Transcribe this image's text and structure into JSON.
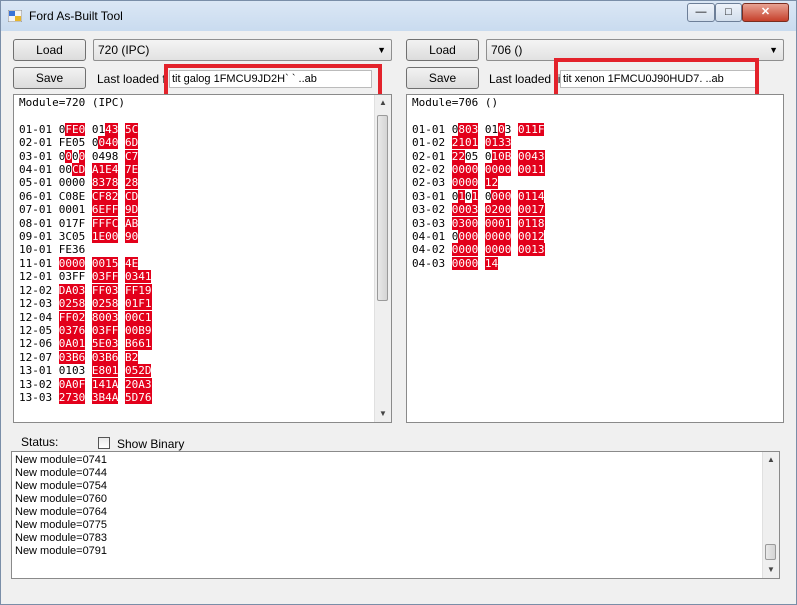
{
  "window": {
    "title": "Ford As-Built Tool",
    "min": "—",
    "max": "□",
    "close": "✕"
  },
  "left": {
    "load_label": "Load",
    "save_label": "Save",
    "module_select": "720 (IPC)",
    "last_loaded_label": "Last loaded file",
    "file_name": "tit galog 1FMCU9JD2H` ` ..ab",
    "header": "Module=720 (IPC)",
    "rows": [
      [
        {
          "t": "01-01 0"
        },
        {
          "t": "FE0",
          "r": 1
        },
        {
          "t": " 01"
        },
        {
          "t": "43",
          "r": 1
        },
        {
          "t": " "
        },
        {
          "t": "5C",
          "r": 1
        }
      ],
      [
        {
          "t": "02-01 FE05 0"
        },
        {
          "t": "040",
          "r": 1
        },
        {
          "t": " "
        },
        {
          "t": "6D",
          "r": 1
        }
      ],
      [
        {
          "t": "03-01 0"
        },
        {
          "t": "0",
          "r": 1
        },
        {
          "t": "0"
        },
        {
          "t": "0",
          "r": 1
        },
        {
          "t": " 0498 "
        },
        {
          "t": "C7",
          "r": 1
        }
      ],
      [
        {
          "t": "04-01 00"
        },
        {
          "t": "CD",
          "r": 1
        },
        {
          "t": " "
        },
        {
          "t": "A1E4",
          "r": 1
        },
        {
          "t": " "
        },
        {
          "t": "7E",
          "r": 1
        }
      ],
      [
        {
          "t": "05-01 0000 "
        },
        {
          "t": "8378",
          "r": 1
        },
        {
          "t": " "
        },
        {
          "t": "28",
          "r": 1
        }
      ],
      [
        {
          "t": "06-01 C08E "
        },
        {
          "t": "CF82",
          "r": 1
        },
        {
          "t": " "
        },
        {
          "t": "CD",
          "r": 1
        }
      ],
      [
        {
          "t": "07-01 0001 "
        },
        {
          "t": "6EFF",
          "r": 1
        },
        {
          "t": " "
        },
        {
          "t": "9D",
          "r": 1
        }
      ],
      [
        {
          "t": "08-01 017F "
        },
        {
          "t": "FFFC",
          "r": 1
        },
        {
          "t": " "
        },
        {
          "t": "AB",
          "r": 1
        }
      ],
      [
        {
          "t": "09-01 3C05 "
        },
        {
          "t": "1E00",
          "r": 1
        },
        {
          "t": " "
        },
        {
          "t": "90",
          "r": 1
        }
      ],
      [
        {
          "t": "10-01 FE36"
        }
      ],
      [
        {
          "t": "11-01 "
        },
        {
          "t": "0000",
          "r": 1
        },
        {
          "t": " "
        },
        {
          "t": "0015",
          "r": 1
        },
        {
          "t": " "
        },
        {
          "t": "4E",
          "r": 1
        }
      ],
      [
        {
          "t": "12-01 03FF "
        },
        {
          "t": "03FF",
          "r": 1
        },
        {
          "t": " "
        },
        {
          "t": "0341",
          "r": 1
        }
      ],
      [
        {
          "t": "12-02 "
        },
        {
          "t": "DA03",
          "r": 1
        },
        {
          "t": " "
        },
        {
          "t": "FF03",
          "r": 1
        },
        {
          "t": " "
        },
        {
          "t": "FF19",
          "r": 1
        }
      ],
      [
        {
          "t": "12-03 "
        },
        {
          "t": "0258",
          "r": 1
        },
        {
          "t": " "
        },
        {
          "t": "0258",
          "r": 1
        },
        {
          "t": " "
        },
        {
          "t": "01F1",
          "r": 1
        }
      ],
      [
        {
          "t": "12-04 "
        },
        {
          "t": "FF02",
          "r": 1
        },
        {
          "t": " "
        },
        {
          "t": "8003",
          "r": 1
        },
        {
          "t": " "
        },
        {
          "t": "00C1",
          "r": 1
        }
      ],
      [
        {
          "t": "12-05 "
        },
        {
          "t": "0376",
          "r": 1
        },
        {
          "t": " "
        },
        {
          "t": "03FF",
          "r": 1
        },
        {
          "t": " "
        },
        {
          "t": "00B9",
          "r": 1
        }
      ],
      [
        {
          "t": "12-06 "
        },
        {
          "t": "0A01",
          "r": 1
        },
        {
          "t": " "
        },
        {
          "t": "5E03",
          "r": 1
        },
        {
          "t": " "
        },
        {
          "t": "B661",
          "r": 1
        }
      ],
      [
        {
          "t": "12-07 "
        },
        {
          "t": "03B6",
          "r": 1
        },
        {
          "t": " "
        },
        {
          "t": "03B6",
          "r": 1
        },
        {
          "t": " "
        },
        {
          "t": "B2",
          "r": 1
        }
      ],
      [
        {
          "t": "13-01 0103 "
        },
        {
          "t": "E801",
          "r": 1
        },
        {
          "t": " "
        },
        {
          "t": "052D",
          "r": 1
        }
      ],
      [
        {
          "t": "13-02 "
        },
        {
          "t": "0A0F",
          "r": 1
        },
        {
          "t": " "
        },
        {
          "t": "141A",
          "r": 1
        },
        {
          "t": " "
        },
        {
          "t": "20A3",
          "r": 1
        }
      ],
      [
        {
          "t": "13-03 "
        },
        {
          "t": "2730",
          "r": 1
        },
        {
          "t": " "
        },
        {
          "t": "3B4A",
          "r": 1
        },
        {
          "t": " "
        },
        {
          "t": "5D76",
          "r": 1
        }
      ]
    ]
  },
  "right": {
    "load_label": "Load",
    "save_label": "Save",
    "module_select": "706 ()",
    "last_loaded_label": "Last loaded file",
    "file_name": "tit xenon 1FMCU0J90HUD7.  ..ab",
    "header": "Module=706 ()",
    "rows": [
      [
        {
          "t": "01-01 0"
        },
        {
          "t": "803",
          "r": 1
        },
        {
          "t": " 01"
        },
        {
          "t": "0",
          "r": 1
        },
        {
          "t": "3 "
        },
        {
          "t": "011F",
          "r": 1
        }
      ],
      [
        {
          "t": "01-02 "
        },
        {
          "t": "2101",
          "r": 1
        },
        {
          "t": " "
        },
        {
          "t": "0",
          "r": 1
        },
        {
          "t": "133",
          "r": 1
        }
      ],
      [
        {
          "t": "02-01 "
        },
        {
          "t": "22",
          "r": 1
        },
        {
          "t": "05 0"
        },
        {
          "t": "10B",
          "r": 1
        },
        {
          "t": " "
        },
        {
          "t": "0043",
          "r": 1
        }
      ],
      [
        {
          "t": "02-02 "
        },
        {
          "t": "0000",
          "r": 1
        },
        {
          "t": " "
        },
        {
          "t": "0000",
          "r": 1
        },
        {
          "t": " "
        },
        {
          "t": "0011",
          "r": 1
        }
      ],
      [
        {
          "t": "02-03 "
        },
        {
          "t": "0000",
          "r": 1
        },
        {
          "t": " "
        },
        {
          "t": "12",
          "r": 1
        }
      ],
      [
        {
          "t": "03-01 0"
        },
        {
          "t": "1",
          "r": 1
        },
        {
          "t": "0"
        },
        {
          "t": "1",
          "r": 1
        },
        {
          "t": " 0"
        },
        {
          "t": "000",
          "r": 1
        },
        {
          "t": " "
        },
        {
          "t": "0114",
          "r": 1
        }
      ],
      [
        {
          "t": "03-02 "
        },
        {
          "t": "0003",
          "r": 1
        },
        {
          "t": " "
        },
        {
          "t": "0200",
          "r": 1
        },
        {
          "t": " "
        },
        {
          "t": "0017",
          "r": 1
        }
      ],
      [
        {
          "t": "03-03 "
        },
        {
          "t": "0300",
          "r": 1
        },
        {
          "t": " "
        },
        {
          "t": "0001",
          "r": 1
        },
        {
          "t": " "
        },
        {
          "t": "0118",
          "r": 1
        }
      ],
      [
        {
          "t": "04-01 0"
        },
        {
          "t": "000",
          "r": 1
        },
        {
          "t": " "
        },
        {
          "t": "0000",
          "r": 1
        },
        {
          "t": " "
        },
        {
          "t": "0012",
          "r": 1
        }
      ],
      [
        {
          "t": "04-02 "
        },
        {
          "t": "0000",
          "r": 1
        },
        {
          "t": " "
        },
        {
          "t": "0000",
          "r": 1
        },
        {
          "t": " "
        },
        {
          "t": "0013",
          "r": 1
        }
      ],
      [
        {
          "t": "04-03 "
        },
        {
          "t": "0000",
          "r": 1
        },
        {
          "t": " "
        },
        {
          "t": "14",
          "r": 1
        }
      ]
    ]
  },
  "status": {
    "label": "Status:",
    "show_binary_label": "Show Binary",
    "show_binary_checked": false,
    "lines": [
      "New module=0741",
      "New module=0744",
      "New module=0754",
      "New module=0760",
      "New module=0764",
      "New module=0775",
      "New module=0783",
      "New module=0791"
    ]
  },
  "colors": {
    "highlight": "#e3001b",
    "annotation_box": "#e3222b"
  },
  "icons": {
    "app": "app-icon",
    "dropdown": "chevron-down-icon",
    "scroll_up": "scroll-up-icon",
    "scroll_down": "scroll-down-icon"
  }
}
